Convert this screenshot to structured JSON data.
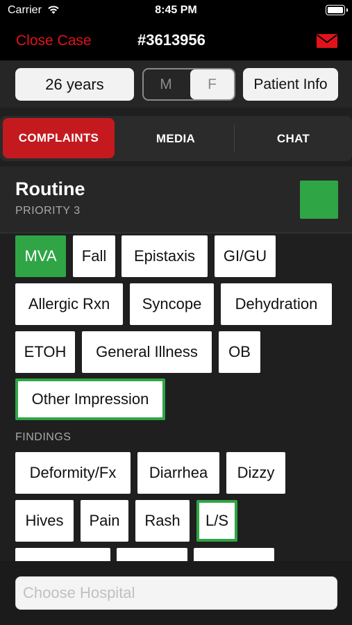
{
  "status_bar": {
    "carrier": "Carrier",
    "time": "8:45 PM",
    "wifi_icon": "wifi-icon",
    "battery_icon": "battery-icon"
  },
  "nav": {
    "close_label": "Close Case",
    "case_number": "#3613956",
    "mail_icon": "mail-icon",
    "accent_color": "#e0131a"
  },
  "patient": {
    "age": "26 years",
    "sex_options": [
      "M",
      "F"
    ],
    "sex_selected": "F",
    "info_label": "Patient Info"
  },
  "tabs": [
    {
      "label": "COMPLAINTS",
      "selected": true
    },
    {
      "label": "MEDIA",
      "selected": false
    },
    {
      "label": "CHAT",
      "selected": false
    }
  ],
  "priority": {
    "title": "Routine",
    "level": "PRIORITY 3",
    "color": "#2fa545"
  },
  "impressions": [
    {
      "label": "MVA",
      "state": "selected"
    },
    {
      "label": "Fall",
      "state": "normal"
    },
    {
      "label": "Epistaxis",
      "state": "normal"
    },
    {
      "label": "GI/GU",
      "state": "normal"
    },
    {
      "label": "Allergic Rxn",
      "state": "normal"
    },
    {
      "label": "Syncope",
      "state": "normal"
    },
    {
      "label": "Dehydration",
      "state": "normal"
    },
    {
      "label": "ETOH",
      "state": "normal"
    },
    {
      "label": "General Illness",
      "state": "normal"
    },
    {
      "label": "OB",
      "state": "normal"
    },
    {
      "label": "Other Impression",
      "state": "outlined"
    }
  ],
  "findings_label": "FINDINGS",
  "findings": [
    {
      "label": "Deformity/Fx",
      "state": "normal"
    },
    {
      "label": "Diarrhea",
      "state": "normal"
    },
    {
      "label": "Dizzy",
      "state": "normal"
    },
    {
      "label": "Hives",
      "state": "normal"
    },
    {
      "label": "Pain",
      "state": "normal"
    },
    {
      "label": "Rash",
      "state": "normal"
    },
    {
      "label": "L/S",
      "state": "outlined"
    },
    {
      "label": "",
      "state": "normal"
    },
    {
      "label": "",
      "state": "normal"
    },
    {
      "label": "",
      "state": "normal"
    }
  ],
  "hospital": {
    "placeholder": "Choose Hospital",
    "value": ""
  }
}
